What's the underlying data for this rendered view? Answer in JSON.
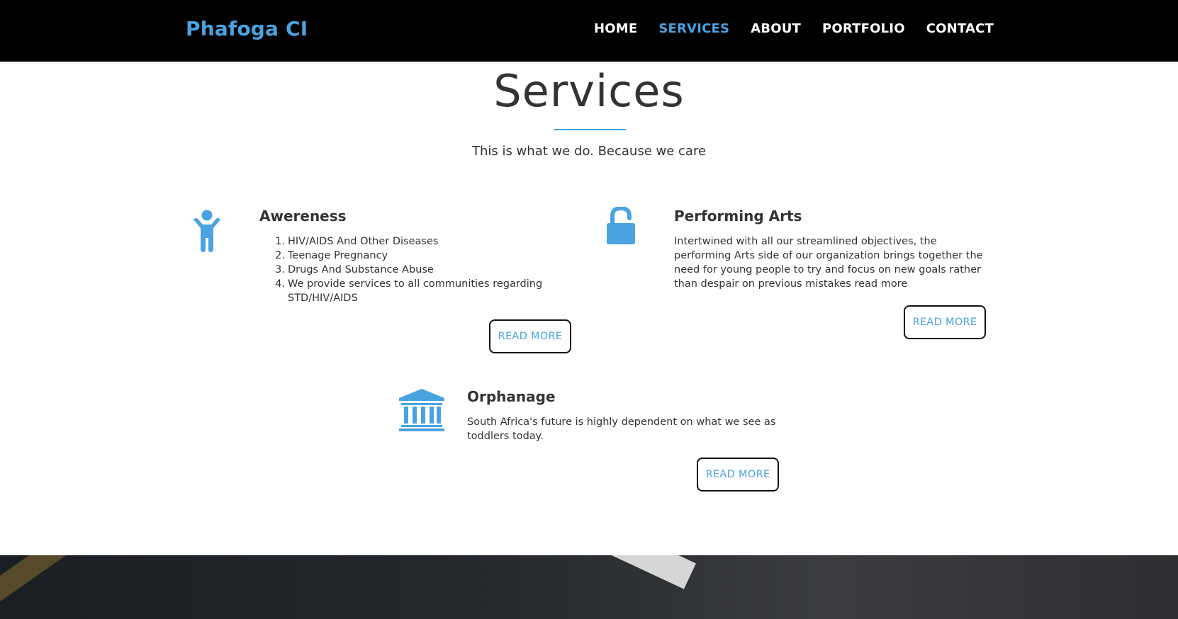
{
  "navbar": {
    "brand": "Phafoga CI",
    "links": [
      {
        "label": "HOME",
        "active": false
      },
      {
        "label": "SERVICES",
        "active": true
      },
      {
        "label": "ABOUT",
        "active": false
      },
      {
        "label": "PORTFOLIO",
        "active": false
      },
      {
        "label": "CONTACT",
        "active": false
      }
    ]
  },
  "section": {
    "title": "Services",
    "subtitle": "This is what we do. Because we care"
  },
  "services": [
    {
      "title": "Awereness",
      "icon": "child-icon",
      "list": [
        "HIV/AIDS And Other Diseases",
        "Teenage Pregnancy",
        "Drugs And Substance Abuse",
        "We provide services to all communities regarding STD/HIV/AIDS"
      ],
      "button": "READ MORE"
    },
    {
      "title": "Performing Arts",
      "icon": "unlock-icon",
      "text": "Intertwined with all our streamlined objectives, the performing Arts side of our organization brings together the need for young people to try and focus on new goals rather than despair on previous mistakes read more",
      "button": "READ MORE"
    },
    {
      "title": "Orphanage",
      "icon": "institution-icon",
      "text": "South Africa's future is highly dependent on what we see as toddlers today.",
      "button": "READ MORE"
    }
  ],
  "colors": {
    "accent": "#4aa3e0",
    "navbar_bg": "#000000",
    "text": "#333333"
  }
}
